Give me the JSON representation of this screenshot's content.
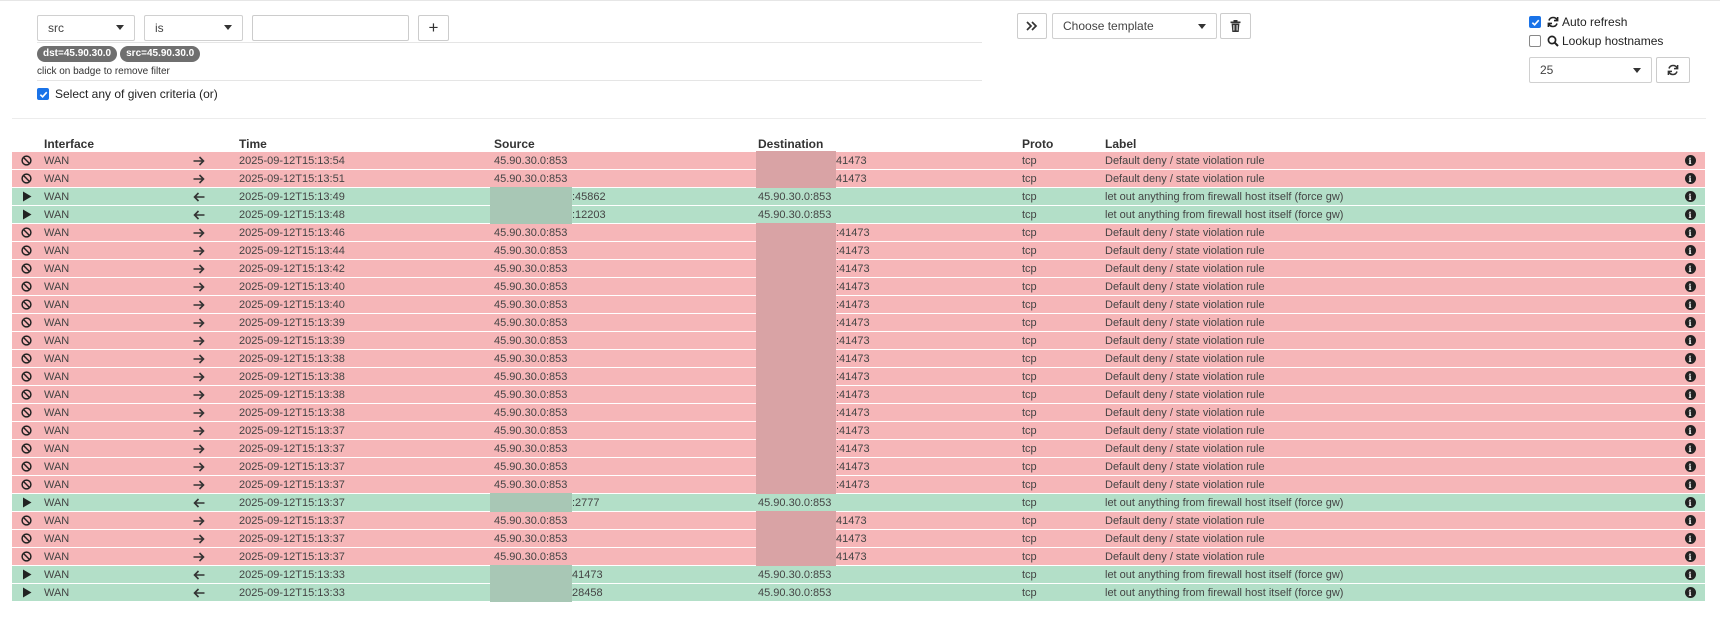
{
  "filters": {
    "field_select": "src",
    "operator_select": "is",
    "value_input": "",
    "add_button": "+",
    "badges": [
      "dst=45.90.30.0",
      "src=45.90.30.0"
    ],
    "badge_hint": "click on badge to remove filter",
    "criteria_label": "Select any of given criteria (or)",
    "criteria_checked": true
  },
  "template": {
    "placeholder": "Choose template"
  },
  "options": {
    "auto_refresh_label": "Auto refresh",
    "auto_refresh_checked": true,
    "lookup_label": "Lookup hostnames",
    "lookup_checked": false,
    "page_size": "25"
  },
  "table": {
    "headers": {
      "interface": "Interface",
      "time": "Time",
      "source": "Source",
      "destination": "Destination",
      "proto": "Proto",
      "label": "Label"
    },
    "rows": [
      {
        "action": "block",
        "iface": "WAN",
        "dir": "out",
        "time": "2025-09-12T15:13:54",
        "src": "45.90.30.0:853",
        "dst": "41473",
        "proto": "tcp",
        "label": "Default deny / state violation rule"
      },
      {
        "action": "block",
        "iface": "WAN",
        "dir": "out",
        "time": "2025-09-12T15:13:51",
        "src": "45.90.30.0:853",
        "dst": "41473",
        "proto": "tcp",
        "label": "Default deny / state violation rule"
      },
      {
        "action": "pass",
        "iface": "WAN",
        "dir": "in",
        "time": "2025-09-12T15:13:49",
        "src": ":45862",
        "dst": "45.90.30.0:853",
        "proto": "tcp",
        "label": "let out anything from firewall host itself (force gw)"
      },
      {
        "action": "pass",
        "iface": "WAN",
        "dir": "in",
        "time": "2025-09-12T15:13:48",
        "src": ":12203",
        "dst": "45.90.30.0:853",
        "proto": "tcp",
        "label": "let out anything from firewall host itself (force gw)"
      },
      {
        "action": "block",
        "iface": "WAN",
        "dir": "out",
        "time": "2025-09-12T15:13:46",
        "src": "45.90.30.0:853",
        "dst": ":41473",
        "proto": "tcp",
        "label": "Default deny / state violation rule"
      },
      {
        "action": "block",
        "iface": "WAN",
        "dir": "out",
        "time": "2025-09-12T15:13:44",
        "src": "45.90.30.0:853",
        "dst": ":41473",
        "proto": "tcp",
        "label": "Default deny / state violation rule"
      },
      {
        "action": "block",
        "iface": "WAN",
        "dir": "out",
        "time": "2025-09-12T15:13:42",
        "src": "45.90.30.0:853",
        "dst": ":41473",
        "proto": "tcp",
        "label": "Default deny / state violation rule"
      },
      {
        "action": "block",
        "iface": "WAN",
        "dir": "out",
        "time": "2025-09-12T15:13:40",
        "src": "45.90.30.0:853",
        "dst": ":41473",
        "proto": "tcp",
        "label": "Default deny / state violation rule"
      },
      {
        "action": "block",
        "iface": "WAN",
        "dir": "out",
        "time": "2025-09-12T15:13:40",
        "src": "45.90.30.0:853",
        "dst": ":41473",
        "proto": "tcp",
        "label": "Default deny / state violation rule"
      },
      {
        "action": "block",
        "iface": "WAN",
        "dir": "out",
        "time": "2025-09-12T15:13:39",
        "src": "45.90.30.0:853",
        "dst": ":41473",
        "proto": "tcp",
        "label": "Default deny / state violation rule"
      },
      {
        "action": "block",
        "iface": "WAN",
        "dir": "out",
        "time": "2025-09-12T15:13:39",
        "src": "45.90.30.0:853",
        "dst": ":41473",
        "proto": "tcp",
        "label": "Default deny / state violation rule"
      },
      {
        "action": "block",
        "iface": "WAN",
        "dir": "out",
        "time": "2025-09-12T15:13:38",
        "src": "45.90.30.0:853",
        "dst": ":41473",
        "proto": "tcp",
        "label": "Default deny / state violation rule"
      },
      {
        "action": "block",
        "iface": "WAN",
        "dir": "out",
        "time": "2025-09-12T15:13:38",
        "src": "45.90.30.0:853",
        "dst": ":41473",
        "proto": "tcp",
        "label": "Default deny / state violation rule"
      },
      {
        "action": "block",
        "iface": "WAN",
        "dir": "out",
        "time": "2025-09-12T15:13:38",
        "src": "45.90.30.0:853",
        "dst": ":41473",
        "proto": "tcp",
        "label": "Default deny / state violation rule"
      },
      {
        "action": "block",
        "iface": "WAN",
        "dir": "out",
        "time": "2025-09-12T15:13:38",
        "src": "45.90.30.0:853",
        "dst": ":41473",
        "proto": "tcp",
        "label": "Default deny / state violation rule"
      },
      {
        "action": "block",
        "iface": "WAN",
        "dir": "out",
        "time": "2025-09-12T15:13:37",
        "src": "45.90.30.0:853",
        "dst": ":41473",
        "proto": "tcp",
        "label": "Default deny / state violation rule"
      },
      {
        "action": "block",
        "iface": "WAN",
        "dir": "out",
        "time": "2025-09-12T15:13:37",
        "src": "45.90.30.0:853",
        "dst": ":41473",
        "proto": "tcp",
        "label": "Default deny / state violation rule"
      },
      {
        "action": "block",
        "iface": "WAN",
        "dir": "out",
        "time": "2025-09-12T15:13:37",
        "src": "45.90.30.0:853",
        "dst": ":41473",
        "proto": "tcp",
        "label": "Default deny / state violation rule"
      },
      {
        "action": "block",
        "iface": "WAN",
        "dir": "out",
        "time": "2025-09-12T15:13:37",
        "src": "45.90.30.0:853",
        "dst": ":41473",
        "proto": "tcp",
        "label": "Default deny / state violation rule"
      },
      {
        "action": "pass",
        "iface": "WAN",
        "dir": "in",
        "time": "2025-09-12T15:13:37",
        "src": ":2777",
        "dst": "45.90.30.0:853",
        "proto": "tcp",
        "label": "let out anything from firewall host itself (force gw)"
      },
      {
        "action": "block",
        "iface": "WAN",
        "dir": "out",
        "time": "2025-09-12T15:13:37",
        "src": "45.90.30.0:853",
        "dst": "41473",
        "proto": "tcp",
        "label": "Default deny / state violation rule"
      },
      {
        "action": "block",
        "iface": "WAN",
        "dir": "out",
        "time": "2025-09-12T15:13:37",
        "src": "45.90.30.0:853",
        "dst": "41473",
        "proto": "tcp",
        "label": "Default deny / state violation rule"
      },
      {
        "action": "block",
        "iface": "WAN",
        "dir": "out",
        "time": "2025-09-12T15:13:37",
        "src": "45.90.30.0:853",
        "dst": "41473",
        "proto": "tcp",
        "label": "Default deny / state violation rule"
      },
      {
        "action": "pass",
        "iface": "WAN",
        "dir": "in",
        "time": "2025-09-12T15:13:33",
        "src": "41473",
        "dst": "45.90.30.0:853",
        "proto": "tcp",
        "label": "let out anything from firewall host itself (force gw)"
      },
      {
        "action": "pass",
        "iface": "WAN",
        "dir": "in",
        "time": "2025-09-12T15:13:33",
        "src": "28458",
        "dst": "45.90.30.0:853",
        "proto": "tcp",
        "label": "let out anything from firewall host itself (force gw)"
      }
    ]
  },
  "colors": {
    "block_row": "#f6b6b8",
    "pass_row": "#b3dfc8",
    "checkbox_accent": "#1a73e8"
  },
  "icons": {
    "block": "ban-icon",
    "pass": "play-icon",
    "out": "arrow-right-icon",
    "in": "arrow-left-icon",
    "info": "info-icon"
  }
}
